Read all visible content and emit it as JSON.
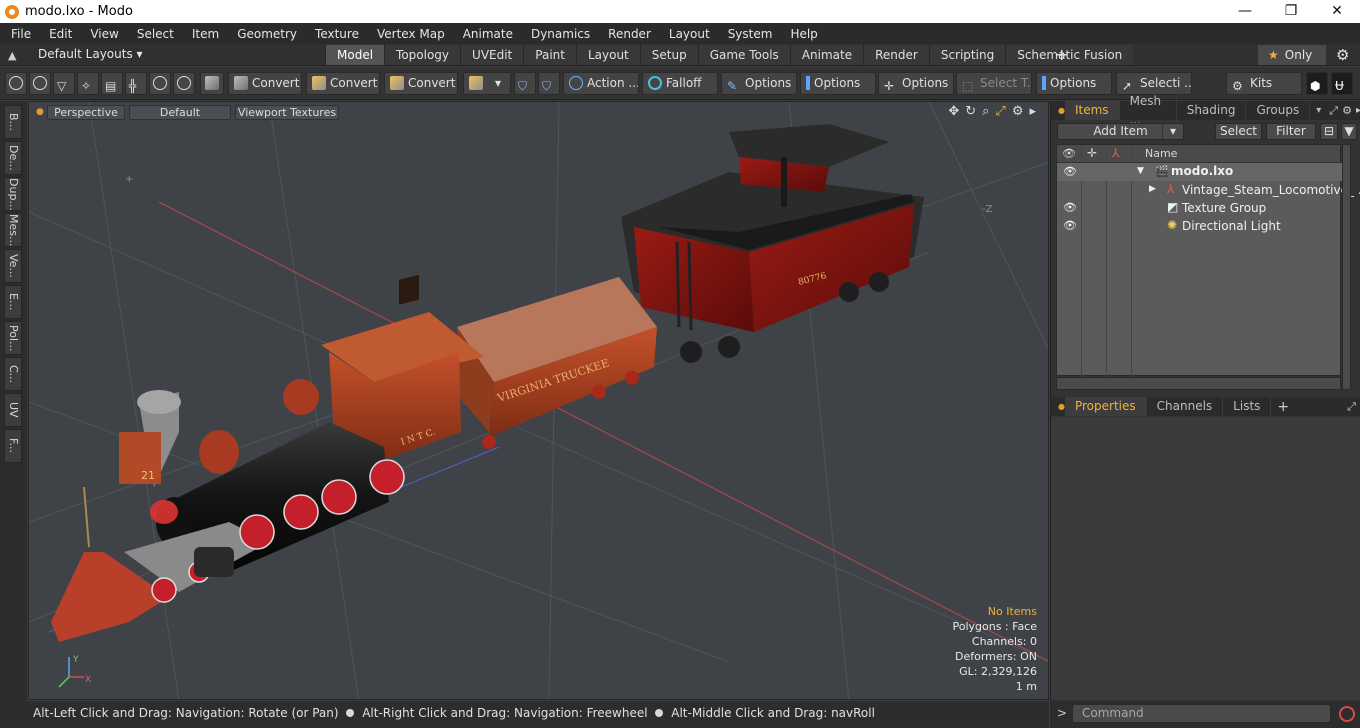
{
  "window": {
    "title": "modo.lxo - Modo",
    "controls": [
      "—",
      "❐",
      "✕"
    ]
  },
  "menu": [
    "File",
    "Edit",
    "View",
    "Select",
    "Item",
    "Geometry",
    "Texture",
    "Vertex Map",
    "Animate",
    "Dynamics",
    "Render",
    "Layout",
    "System",
    "Help"
  ],
  "layoutbar": {
    "layouts_label": "Default Layouts ▾",
    "tabs": [
      "Model",
      "Topology",
      "UVEdit",
      "Paint",
      "Layout",
      "Setup",
      "Game Tools",
      "Animate",
      "Render",
      "Scripting",
      "Schematic Fusion"
    ],
    "active_tab": "Model",
    "plus": "+",
    "only_label": "Only",
    "star": "★"
  },
  "toolbar": {
    "convert1": "Convert",
    "convert2": "Convert",
    "convert3": "Convert",
    "action": "Action ...",
    "falloff": "Falloff",
    "options1": "Options",
    "options2": "Options",
    "options3": "Options",
    "select_t": "Select T...",
    "options4": "Options",
    "selecti": "Selecti ...",
    "kits": "Kits"
  },
  "left_tabs": [
    "B...",
    "De...",
    "Dup...",
    "Mes...",
    "Ve...",
    "E...",
    "Pol...",
    "C...",
    "UV",
    "F..."
  ],
  "viewport": {
    "view_mode": "Perspective",
    "shading": "Default",
    "textures": "Viewport Textures",
    "tool_icons": [
      "✥",
      "↻",
      "⌕",
      "⤢",
      "⚙",
      "▸"
    ],
    "stats": {
      "items": "No Items",
      "polygons": "Polygons : Face",
      "channels": "Channels: 0",
      "deformers": "Deformers: ON",
      "gl": "GL: 2,329,126",
      "scale": "1 m"
    },
    "locomotive_text": "I N T C.",
    "car_text": "VIRGINIA  TRUCKEE",
    "caboose_number": "80776",
    "front_number": "21",
    "axis_x": "X",
    "axis_y": "Y",
    "axis_z": "-Z"
  },
  "status": {
    "hint1": "Alt-Left Click and Drag: Navigation: Rotate (or Pan)",
    "hint2": "Alt-Right Click and Drag: Navigation: Freewheel",
    "hint3": "Alt-Middle Click and Drag: navRoll"
  },
  "items_panel": {
    "tabs": [
      "Items",
      "Mesh ...",
      "Shading",
      "Groups"
    ],
    "active_tab": "Items",
    "add_item": "Add Item",
    "select": "Select",
    "filter": "Filter",
    "column_name": "Name",
    "tree": [
      {
        "label": "modo.lxo",
        "level": 0,
        "eye": true,
        "expanded": true,
        "bold": true
      },
      {
        "label": "Vintage_Steam_Locomotive_ ...",
        "level": 1,
        "eye": false,
        "collapsed": true
      },
      {
        "label": "Texture Group",
        "level": 1,
        "eye": true
      },
      {
        "label": "Directional Light",
        "level": 1,
        "eye": true
      }
    ]
  },
  "properties_panel": {
    "tabs": [
      "Properties",
      "Channels",
      "Lists"
    ],
    "active_tab": "Properties",
    "plus": "+"
  },
  "command": {
    "prompt": ">",
    "placeholder": "Command"
  },
  "colors": {
    "accent": "#f0b23c",
    "viewport_bg": "#3f4347",
    "panel_bg": "#333333"
  }
}
